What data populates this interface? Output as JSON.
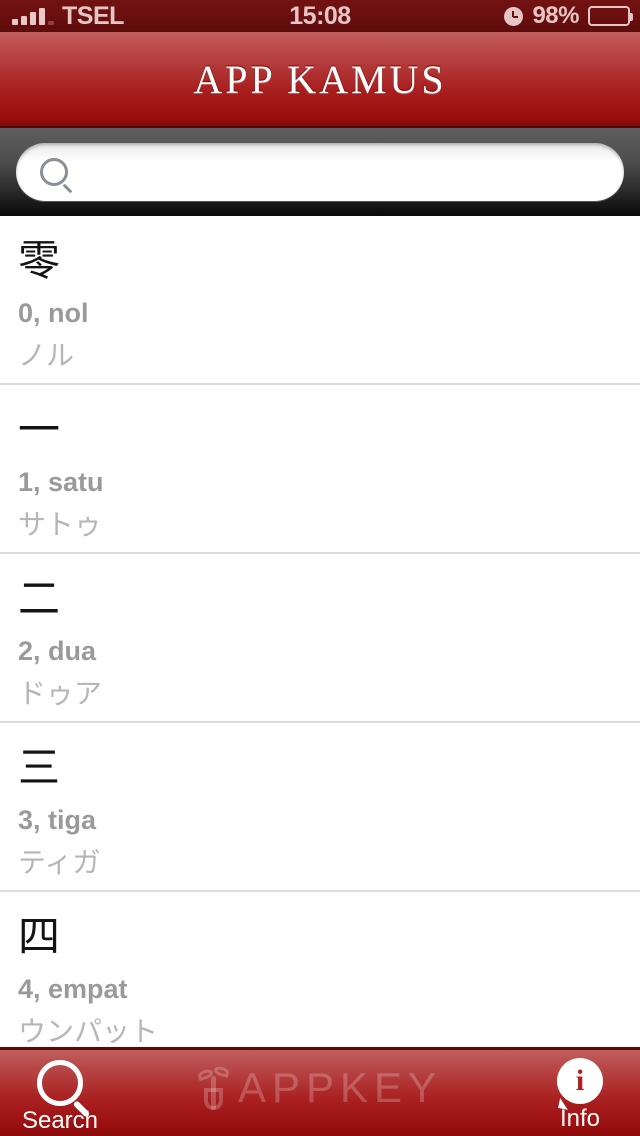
{
  "status_bar": {
    "carrier": "TSEL",
    "time": "15:08",
    "battery_percent": "98%",
    "signal_icon": "signal-bars-icon",
    "alarm_icon": "alarm-clock-icon",
    "battery_icon": "battery-icon"
  },
  "header": {
    "title": "APP KAMUS",
    "gradient_top": "#c35e5e",
    "gradient_bottom": "#9b0d0d"
  },
  "search": {
    "value": "",
    "placeholder": "",
    "icon": "search-icon"
  },
  "list": {
    "entries": [
      {
        "kanji": "零",
        "meaning": "0, nol",
        "reading": "ノル"
      },
      {
        "kanji": "一",
        "meaning": "1, satu",
        "reading": "サトゥ"
      },
      {
        "kanji": "二",
        "meaning": "2, dua",
        "reading": "ドゥア"
      },
      {
        "kanji": "三",
        "meaning": "3, tiga",
        "reading": "ティガ"
      },
      {
        "kanji": "四",
        "meaning": "4, empat",
        "reading": "ウンパット"
      }
    ]
  },
  "tab_bar": {
    "search_label": "Search",
    "info_label": "Info",
    "info_glyph": "i",
    "watermark": "APPKEY",
    "accent_color": "#ab2222"
  }
}
